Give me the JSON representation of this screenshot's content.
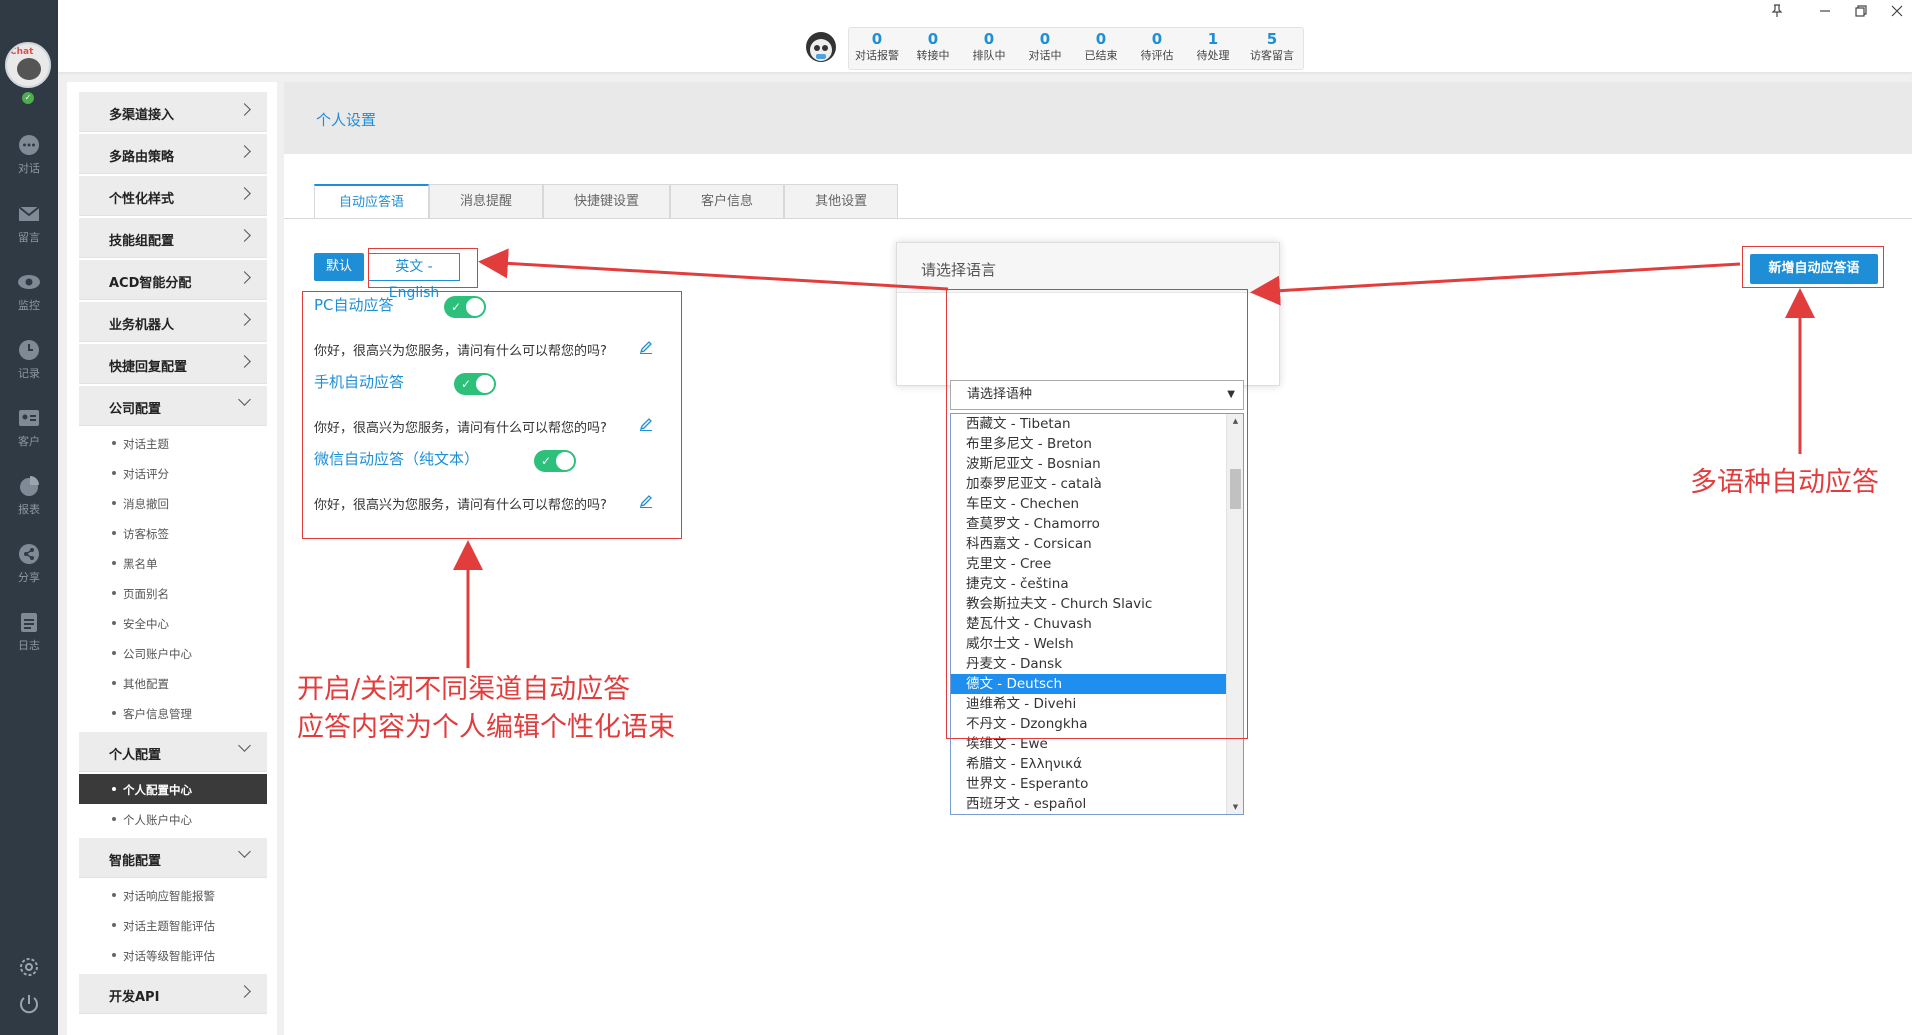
{
  "rail": {
    "items": [
      {
        "label": "对话",
        "icon": "chat-icon"
      },
      {
        "label": "留言",
        "icon": "mail-icon"
      },
      {
        "label": "监控",
        "icon": "eye-icon"
      },
      {
        "label": "记录",
        "icon": "clock-icon"
      },
      {
        "label": "客户",
        "icon": "contact-card-icon"
      },
      {
        "label": "报表",
        "icon": "pie-chart-icon"
      },
      {
        "label": "分享",
        "icon": "share-icon"
      },
      {
        "label": "日志",
        "icon": "clipboard-icon"
      }
    ],
    "avatar_brand": "Chat"
  },
  "topbar": {
    "stats": [
      {
        "num": "0",
        "label": "对话报警"
      },
      {
        "num": "0",
        "label": "转接中"
      },
      {
        "num": "0",
        "label": "排队中"
      },
      {
        "num": "0",
        "label": "对话中"
      },
      {
        "num": "0",
        "label": "已结束"
      },
      {
        "num": "0",
        "label": "待评估"
      },
      {
        "num": "1",
        "label": "待处理"
      },
      {
        "num": "5",
        "label": "访客留言"
      }
    ]
  },
  "menu": {
    "groups_top": [
      "多渠道接入",
      "多路由策略",
      "个性化样式",
      "技能组配置",
      "ACD智能分配",
      "业务机器人",
      "快捷回复配置"
    ],
    "company": {
      "label": "公司配置",
      "items": [
        "对话主题",
        "对话评分",
        "消息撤回",
        "访客标签",
        "黑名单",
        "页面别名",
        "安全中心",
        "公司账户中心",
        "其他配置",
        "客户信息管理"
      ]
    },
    "personal": {
      "label": "个人配置",
      "items": [
        "个人配置中心",
        "个人账户中心"
      ]
    },
    "smart": {
      "label": "智能配置",
      "items": [
        "对话响应智能报警",
        "对话主题智能评估",
        "对话等级智能评估"
      ]
    },
    "api": "开发API"
  },
  "main": {
    "title": "个人设置",
    "tabs": [
      "自动应答语",
      "消息提醒",
      "快捷键设置",
      "客户信息",
      "其他设置"
    ],
    "btn_default": "默认",
    "btn_english": "英文 - English",
    "btn_new": "新增自动应答语",
    "pc_title": "PC自动应答",
    "mobile_title": "手机自动应答",
    "wechat_title": "微信自动应答（纯文本）",
    "reply_text": "你好，很高兴为您服务，请问有什么可以帮您的吗?"
  },
  "dialog": {
    "title": "请选择语言",
    "select_value": "请选择语种",
    "options": [
      "西藏文 - Tibetan",
      "布里多尼文 - Breton",
      "波斯尼亚文 - Bosnian",
      "加泰罗尼亚文 - català",
      "车臣文 - Chechen",
      "查莫罗文 - Chamorro",
      "科西嘉文 - Corsican",
      "克里文 - Cree",
      "捷克文 - čeština",
      "教会斯拉夫文 - Church Slavic",
      "楚瓦什文 - Chuvash",
      "威尔士文 - Welsh",
      "丹麦文 - Dansk",
      "德文 - Deutsch",
      "迪维希文 - Divehi",
      "不丹文 - Dzongkha",
      "埃维文 - Ewe",
      "希腊文 - Ελληνικά",
      "世界文 - Esperanto",
      "西班牙文 - español"
    ],
    "selected": "德文 - Deutsch"
  },
  "notes": {
    "left_line1": "开启/关闭不同渠道自动应答",
    "left_line2": "应答内容为个人编辑个性化语束",
    "right": "多语种自动应答"
  },
  "colors": {
    "accent": "#1e8fd6",
    "annotation": "#e23d3d",
    "toggle_on": "#2dc07a",
    "rail": "#2f3a45"
  }
}
